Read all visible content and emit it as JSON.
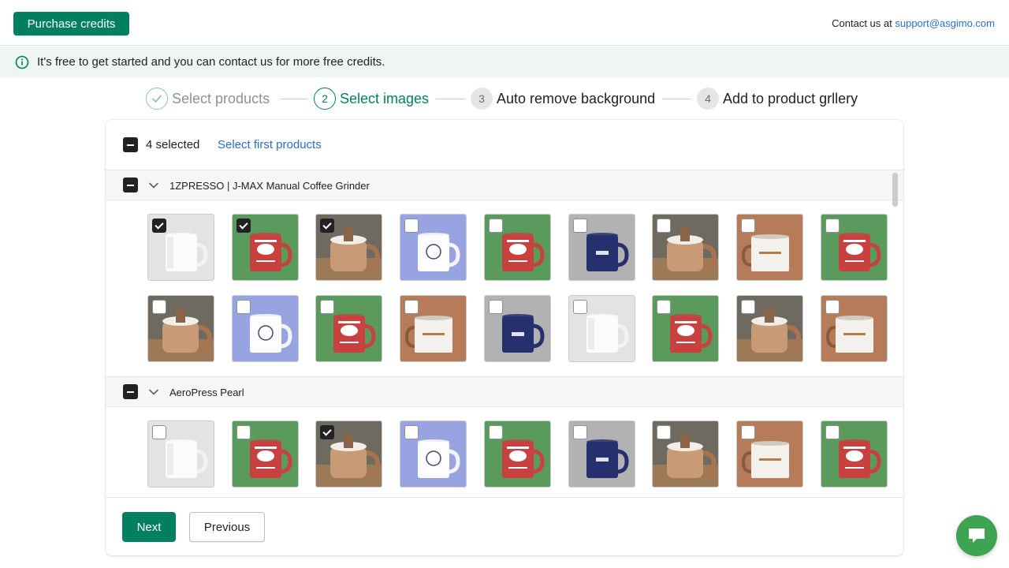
{
  "topbar": {
    "purchase_label": "Purchase credits",
    "contact_prefix": "Contact us at ",
    "contact_email": "support@asgimo.com"
  },
  "banner": {
    "text": "It's free to get started and you can contact us for more free credits.",
    "icon": "info-icon"
  },
  "steps": [
    {
      "number": "",
      "label": "Select products",
      "state": "done"
    },
    {
      "number": "2",
      "label": "Select images",
      "state": "active"
    },
    {
      "number": "3",
      "label": "Auto remove background",
      "state": "pending"
    },
    {
      "number": "4",
      "label": "Add to product grllery",
      "state": "pending"
    }
  ],
  "selection": {
    "count_label": "4 selected",
    "select_first_label": "Select first products"
  },
  "groups": [
    {
      "title": "1ZPRESSO | J-MAX Manual Coffee Grinder",
      "rows": [
        [
          {
            "variant": "white",
            "checked": true
          },
          {
            "variant": "red",
            "checked": true
          },
          {
            "variant": "sweater",
            "checked": true
          },
          {
            "variant": "periwinkle",
            "checked": false
          },
          {
            "variant": "red",
            "checked": false
          },
          {
            "variant": "navy",
            "checked": false
          },
          {
            "variant": "sweater",
            "checked": false
          },
          {
            "variant": "enamel",
            "checked": false
          },
          {
            "variant": "red",
            "checked": false
          }
        ],
        [
          {
            "variant": "sweater",
            "checked": false
          },
          {
            "variant": "periwinkle",
            "checked": false
          },
          {
            "variant": "red",
            "checked": false
          },
          {
            "variant": "enamel",
            "checked": false
          },
          {
            "variant": "navy",
            "checked": false
          },
          {
            "variant": "white",
            "checked": false
          },
          {
            "variant": "red",
            "checked": false
          },
          {
            "variant": "sweater",
            "checked": false
          },
          {
            "variant": "enamel",
            "checked": false
          }
        ]
      ]
    },
    {
      "title": "AeroPress Pearl",
      "rows": [
        [
          {
            "variant": "white",
            "checked": false
          },
          {
            "variant": "red",
            "checked": false
          },
          {
            "variant": "sweater",
            "checked": true
          },
          {
            "variant": "periwinkle",
            "checked": false
          },
          {
            "variant": "red",
            "checked": false
          },
          {
            "variant": "navy",
            "checked": false
          },
          {
            "variant": "sweater",
            "checked": false
          },
          {
            "variant": "enamel",
            "checked": false
          },
          {
            "variant": "red",
            "checked": false
          }
        ]
      ]
    }
  ],
  "footer": {
    "next_label": "Next",
    "previous_label": "Previous"
  },
  "chat": {
    "icon": "chat-icon"
  },
  "colors": {
    "primary": "#008060",
    "link": "#2c6ecb",
    "banner_bg": "#eef5f3",
    "chat": "#3fa452"
  }
}
